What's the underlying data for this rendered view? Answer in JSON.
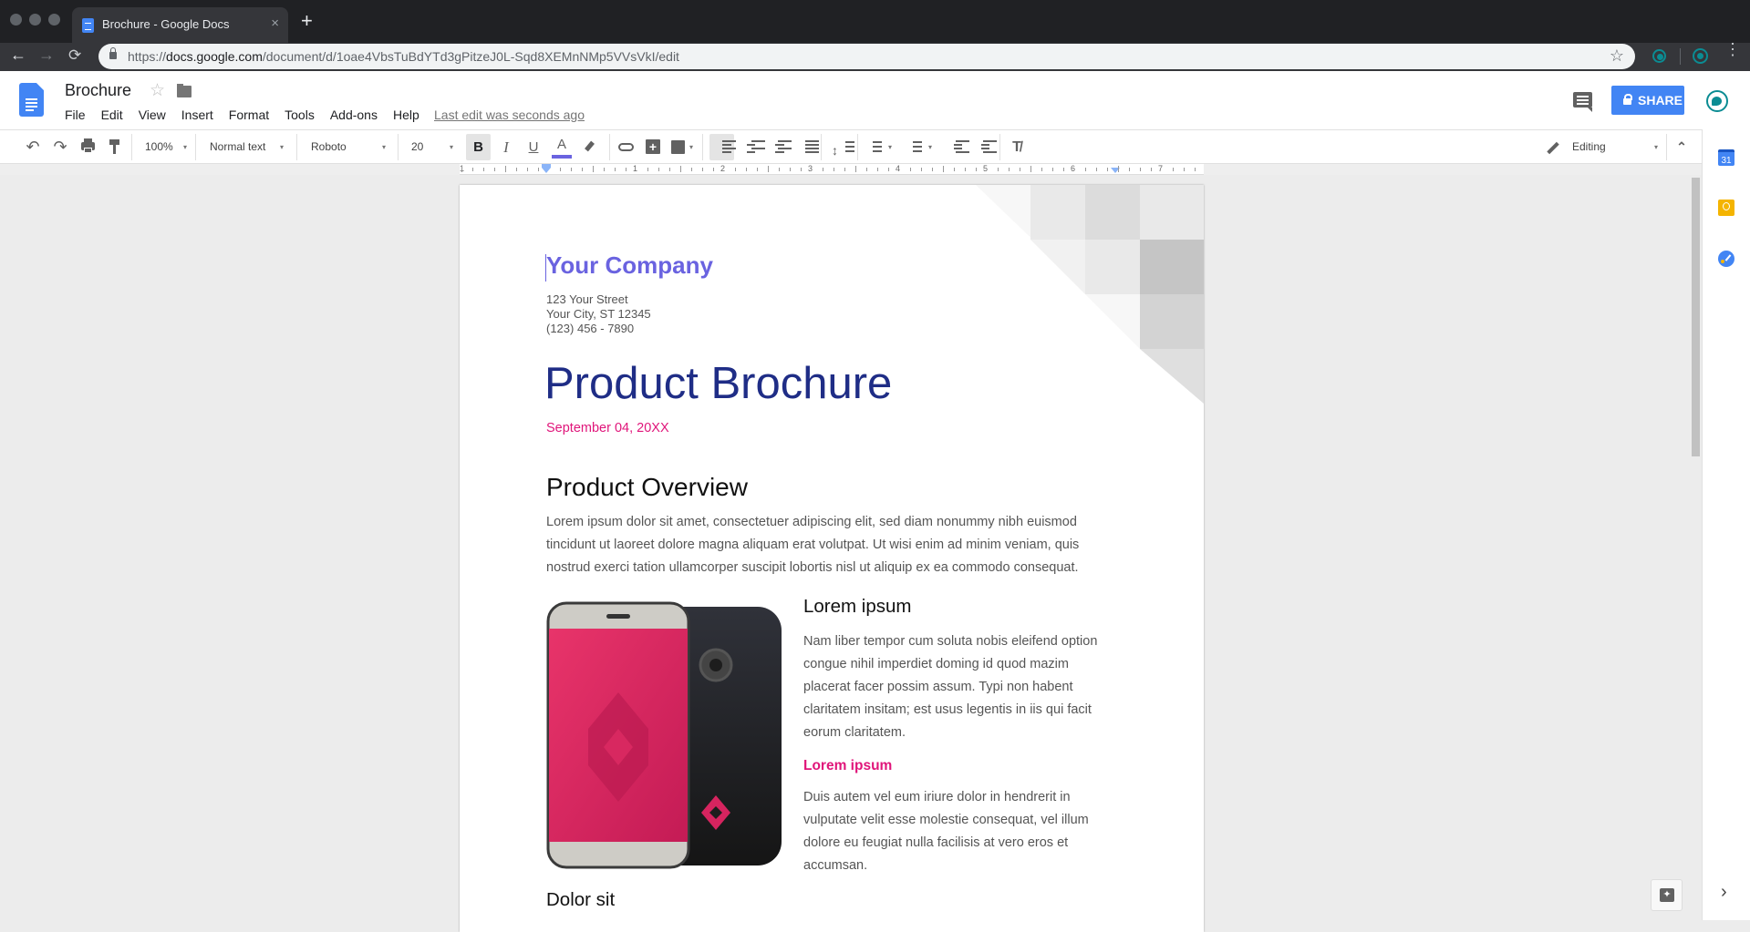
{
  "browser": {
    "tab_title": "Brochure - Google Docs",
    "tab_close": "×",
    "new_tab": "+",
    "url_prefix": "https://",
    "url_domain": "docs.google.com",
    "url_path": "/document/d/1oae4VbsTuBdYTd3gPitzeJ0L-Sqd8XEMnNMp5VVsVkI/edit",
    "back": "←",
    "forward": "→",
    "reload": "⟳",
    "bookmark_star": "☆",
    "menu": "⋮"
  },
  "header": {
    "doc_title": "Brochure",
    "star": "☆",
    "menus": [
      "File",
      "Edit",
      "View",
      "Insert",
      "Format",
      "Tools",
      "Add-ons",
      "Help"
    ],
    "last_edit": "Last edit was seconds ago",
    "share_label": "SHARE"
  },
  "toolbar": {
    "undo": "↶",
    "redo": "↷",
    "zoom": "100%",
    "style": "Normal text",
    "font": "Roboto",
    "size": "20",
    "bold": "B",
    "italic": "I",
    "underline": "U",
    "text_color": "A",
    "text_color_value": "#6a63e0",
    "mode": "Editing",
    "caret": "▾",
    "collapse": "⌃"
  },
  "ruler": {
    "labels": [
      "1",
      "1",
      "2",
      "3",
      "4",
      "5",
      "6",
      "7"
    ]
  },
  "document": {
    "company": "Your Company",
    "address": [
      "123 Your Street",
      "Your City, ST 12345",
      "(123) 456 - 7890"
    ],
    "title": "Product Brochure",
    "date": "September 04, 20XX",
    "overview_heading": "Product Overview",
    "overview_lines": [
      "Lorem ipsum dolor sit amet, consectetuer adipiscing elit, sed diam nonummy nibh euismod",
      "tincidunt ut laoreet dolore magna aliquam erat volutpat. Ut wisi enim ad minim veniam, quis",
      "nostrud exerci tation ullamcorper suscipit lobortis nisl ut aliquip ex ea commodo consequat."
    ],
    "side_heading": "Lorem ipsum",
    "side_lines": [
      "Nam liber tempor cum soluta nobis eleifend option",
      "congue nihil imperdiet doming id quod mazim",
      "placerat facer possim assum. Typi non habent",
      "claritatem insitam; est usus legentis in iis qui facit",
      "eorum claritatem."
    ],
    "side_subheading": "Lorem ipsum",
    "side_lines2": [
      "Duis autem vel eum iriure dolor in hendrerit in",
      "vulputate velit esse molestie consequat, vel illum",
      "dolore eu feugiat nulla facilisis at vero eros et",
      "accumsan."
    ],
    "next_heading": "Dolor sit"
  },
  "colors": {
    "company": "#6a63e0",
    "title": "#1f2d86",
    "accent": "#e0157a",
    "share": "#4285f4"
  },
  "sidepanel": {
    "calendar_day": "31",
    "expand": "›"
  }
}
